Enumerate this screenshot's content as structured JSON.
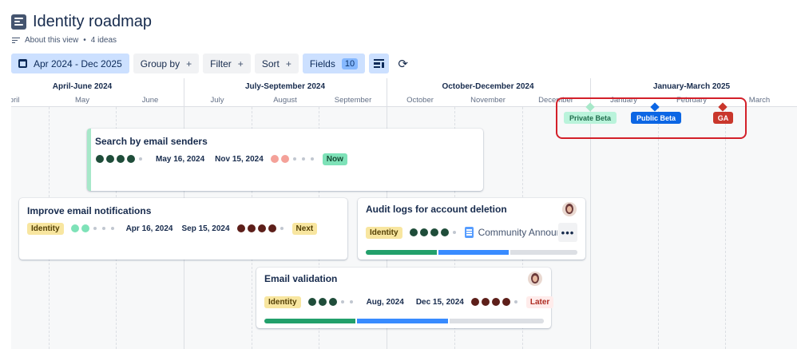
{
  "header": {
    "title": "Identity roadmap",
    "about": "About this view",
    "ideas_count": "4 ideas"
  },
  "toolbar": {
    "date_range": "Apr 2024 - Dec 2025",
    "group_by": "Group by",
    "filter": "Filter",
    "sort": "Sort",
    "fields": "Fields",
    "fields_count": "10",
    "plus": "+"
  },
  "timeline": {
    "quarters": [
      "April-June 2024",
      "July-September 2024",
      "October-December 2024",
      "January-March 2025"
    ],
    "months": [
      "pril",
      "May",
      "June",
      "July",
      "August",
      "September",
      "October",
      "November",
      "December",
      "January",
      "February",
      "March"
    ]
  },
  "milestones": [
    {
      "label": "Private Beta",
      "color": "#baf3db",
      "text_color": "#216e4e",
      "diamond": "#a7e8c9"
    },
    {
      "label": "Public Beta",
      "color": "#0c66e4",
      "text_color": "#ffffff",
      "diamond": "#0c66e4"
    },
    {
      "label": "GA",
      "color": "#c9372c",
      "text_color": "#ffffff",
      "diamond": "#c9372c"
    }
  ],
  "highlight_color": "#d3202a",
  "cards": [
    {
      "title": "Search by email senders",
      "start": "May 16, 2024",
      "end": "Nov 15, 2024",
      "status": "Now",
      "impact_filled": 4,
      "impact_color": "#1f4d3a",
      "effort_filled": 2,
      "effort_color": "#f4a199"
    },
    {
      "title": "Improve email notifications",
      "tag": "Identity",
      "start": "Apr 16, 2024",
      "end": "Sep 15, 2024",
      "status": "Next",
      "impact_filled": 2,
      "impact_color": "#7ee2b8",
      "effort_filled": 4,
      "effort_color": "#5d1f1a"
    },
    {
      "title": "Audit logs for account deletion",
      "tag": "Identity",
      "doc": "Community Announcement",
      "more": "•••",
      "impact_filled": 4,
      "impact_color": "#1f4d3a",
      "progress": [
        0.34,
        0.34,
        0.32
      ]
    },
    {
      "title": "Email validation",
      "tag": "Identity",
      "start": "Aug, 2024",
      "end": "Dec 15, 2024",
      "status": "Later",
      "impact_filled": 3,
      "impact_color": "#1f4d3a",
      "effort_filled": 4,
      "effort_color": "#5d1f1a",
      "progress": [
        0.33,
        0.33,
        0.34
      ]
    }
  ],
  "colors": {
    "progress_done": "#22a06b",
    "progress_active": "#388bff",
    "progress_todo": "#dcdfe4"
  }
}
